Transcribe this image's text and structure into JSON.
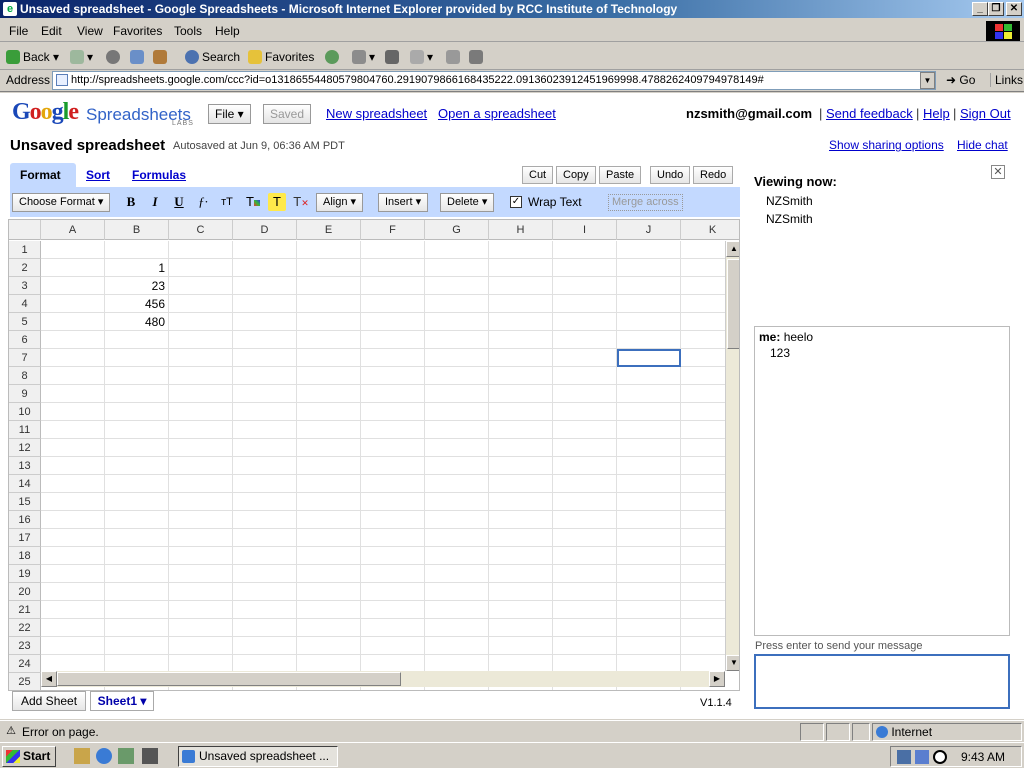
{
  "window": {
    "title": "Unsaved spreadsheet - Google Spreadsheets - Microsoft Internet Explorer provided by RCC Institute of Technology"
  },
  "menubar": {
    "items": [
      "File",
      "Edit",
      "View",
      "Favorites",
      "Tools",
      "Help"
    ]
  },
  "toolbar": {
    "back": "Back",
    "search": "Search",
    "favorites": "Favorites"
  },
  "addressbar": {
    "label": "Address",
    "url": "http://spreadsheets.google.com/ccc?id=o13186554480579804760.2919079866168435222.09136023912451969998.4788262409794978149#",
    "go": "Go",
    "links": "Links"
  },
  "app": {
    "brand": "Google",
    "product": "Spreadsheets",
    "labs": "LABS",
    "file_menu": "File ▾",
    "saved_button": "Saved",
    "new_spreadsheet": "New spreadsheet",
    "open_spreadsheet": "Open a spreadsheet",
    "user_email": "nzsmith@gmail.com",
    "send_feedback": "Send feedback",
    "help": "Help",
    "sign_out": "Sign Out",
    "separator": "|"
  },
  "doc": {
    "title": "Unsaved spreadsheet",
    "autosave": "Autosaved at Jun 9, 06:36 AM PDT",
    "show_sharing": "Show sharing options",
    "hide_chat": "Hide chat"
  },
  "tabs": [
    "Format",
    "Sort",
    "Formulas"
  ],
  "edit_buttons": {
    "cut": "Cut",
    "copy": "Copy",
    "paste": "Paste",
    "undo": "Undo",
    "redo": "Redo"
  },
  "format_bar": {
    "choose_format": "Choose Format ▾",
    "bold": "B",
    "italic": "I",
    "underline": "U",
    "align": "Align ▾",
    "insert": "Insert ▾",
    "delete": "Delete ▾",
    "wrap_text": "Wrap Text",
    "wrap_checked": "✓",
    "merge_across": "Merge across"
  },
  "grid": {
    "columns": [
      "A",
      "B",
      "C",
      "D",
      "E",
      "F",
      "G",
      "H",
      "I",
      "J",
      "K"
    ],
    "rows": [
      "1",
      "2",
      "3",
      "4",
      "5",
      "6",
      "7",
      "8",
      "9",
      "10",
      "11",
      "12",
      "13",
      "14",
      "15",
      "16",
      "17",
      "18",
      "19",
      "20",
      "21",
      "22",
      "23",
      "24",
      "25"
    ],
    "cells": [
      {
        "ref": "B2",
        "value": "1"
      },
      {
        "ref": "B3",
        "value": "23"
      },
      {
        "ref": "B4",
        "value": "456"
      },
      {
        "ref": "B5",
        "value": "480"
      }
    ],
    "selected": "J7"
  },
  "sheets": {
    "add_sheet": "Add Sheet",
    "active": "Sheet1 ▾",
    "version": "V1.1.4"
  },
  "chat": {
    "viewing_now": "Viewing now:",
    "viewers": [
      "NZSmith",
      "NZSmith"
    ],
    "messages": [
      {
        "sender": "me:",
        "text": "heelo"
      },
      {
        "sender": "",
        "text": "123"
      }
    ],
    "input_hint": "Press enter to send your message"
  },
  "statusbar": {
    "message": "Error on page.",
    "zone": "Internet"
  },
  "taskbar": {
    "start": "Start",
    "app": "Unsaved spreadsheet ...",
    "clock": "9:43 AM"
  }
}
